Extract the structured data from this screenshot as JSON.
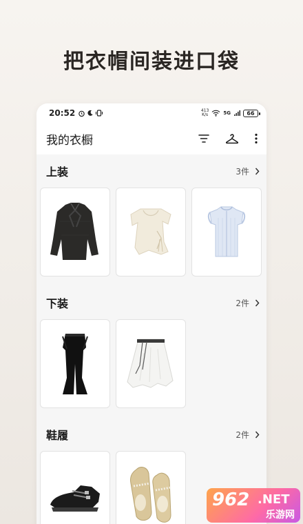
{
  "headline": "把衣帽间装进口袋",
  "status_bar": {
    "time": "20:52",
    "net_speed_value": "413",
    "net_speed_unit": "K/s",
    "signal_label": "5G",
    "battery": "66"
  },
  "app_bar": {
    "title": "我的衣橱",
    "icons": [
      "filter-icon",
      "hanger-icon",
      "more-vertical-icon"
    ]
  },
  "sections": [
    {
      "name": "上装",
      "count": "3件",
      "items": [
        "black-bow-blouse",
        "cream-drape-top",
        "blue-ruffle-shirt"
      ]
    },
    {
      "name": "下装",
      "count": "2件",
      "items": [
        "black-flare-pants",
        "white-belted-skirt"
      ]
    },
    {
      "name": "鞋履",
      "count": "2件",
      "items": [
        "black-buckle-shoes",
        "gold-ballet-flats"
      ]
    }
  ],
  "watermark": {
    "number": "962",
    "suffix": ".NET",
    "text": "乐游网"
  },
  "colors": {
    "background": "#f2eee9",
    "panel": "#f6f6f6",
    "card": "#ffffff",
    "text": "#1a1a1a"
  }
}
